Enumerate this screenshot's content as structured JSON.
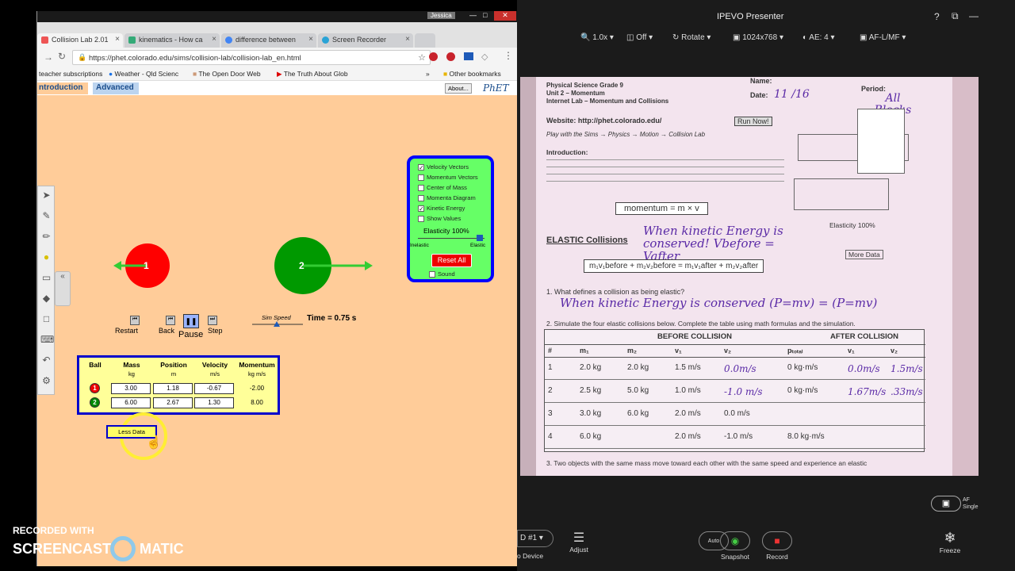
{
  "browser": {
    "titlebar_user": "Jessica",
    "tabs": [
      {
        "label": "Collision Lab 2.01",
        "active": true
      },
      {
        "label": "kinematics - How ca"
      },
      {
        "label": "difference between"
      },
      {
        "label": "Screen Recorder"
      }
    ],
    "url": "https://phet.colorado.edu/sims/collision-lab/collision-lab_en.html",
    "bookmarks": [
      "teacher subscriptions",
      "Weather - Qld Scienc",
      "The Open Door Web",
      "The Truth About Glob",
      "Other bookmarks"
    ]
  },
  "sim": {
    "tabs": {
      "intro": "ntroduction",
      "advanced": "Advanced"
    },
    "about": "About...",
    "logo": "PhET",
    "ball1_label": "1",
    "ball2_label": "2",
    "controls": {
      "restart": "Restart",
      "back": "Back",
      "pause": "Pause",
      "step": "Step"
    },
    "sim_speed": "Sim Speed",
    "time": "Time = 0.75 s",
    "panel": {
      "velocity_vectors": "Velocity Vectors",
      "momentum_vectors": "Momentum Vectors",
      "center_of_mass": "Center of Mass",
      "momenta_diagram": "Momenta Diagram",
      "kinetic_energy": "Kinetic Energy",
      "show_values": "Show Values",
      "elasticity": "Elasticity 100%",
      "inelastic": "Inelastic",
      "elastic": "Elastic",
      "reset_all": "Reset All",
      "sound": "Sound"
    },
    "table": {
      "headers": [
        "Ball",
        "Mass",
        "Position",
        "Velocity",
        "Momentum"
      ],
      "units": [
        "kg",
        "m",
        "m/s",
        "kg m/s"
      ],
      "rows": [
        {
          "ball": "1",
          "mass": "3.00",
          "position": "1.18",
          "velocity": "-0.67",
          "momentum": "-2.00"
        },
        {
          "ball": "2",
          "mass": "6.00",
          "position": "2.67",
          "velocity": "1.30",
          "momentum": "8.00"
        }
      ],
      "less_data": "Less Data"
    }
  },
  "presenter": {
    "title": "IPEVO Presenter",
    "toolbar": {
      "zoom": "1.0x",
      "off": "Off",
      "rotate": "Rotate",
      "resolution": "1024x768",
      "ae": "AE: 4",
      "af": "AF-L/MF"
    },
    "worksheet": {
      "line1": "Physical Science  Grade 9",
      "line2": "Unit 2 – Momentum",
      "line3": "Internet Lab – Momentum and Collisions",
      "name_label": "Name:",
      "date_label": "Date:",
      "date_value": "11 /16",
      "period_label": "Period:",
      "period_value": "All Blocks",
      "website": "Website: http://phet.colorado.edu/",
      "play": "Play with the Sims → Physics → Motion → Collision Lab",
      "run_now": "Run Now!",
      "intro": "Introduction:",
      "momentum_eq": "momentum = m × v",
      "elastic_title": "ELASTIC Collisions",
      "elastic_hw": "When kinetic Energy is conserved! Vbefore = Vafter",
      "equation": "m₁v₁before + m₂v₂before = m₁v₁after + m₂v₂after",
      "more_data": "More Data",
      "elasticity": "Elasticity 100%",
      "q1": "1.  What defines a collision as being elastic?",
      "q1_hw": "When kinetic Energy is conserved  (P=mv) = (P=mv)",
      "q2": "2.  Simulate the four elastic collisions below.  Complete the table using math formulas and the simulation.",
      "before": "BEFORE COLLISION",
      "after": "AFTER COLLISION",
      "cols": [
        "#",
        "m₁",
        "m₂",
        "v₁",
        "v₂",
        "pₜₒₜₐₗ",
        "v₁",
        "v₂"
      ],
      "rows": [
        [
          "1",
          "2.0 kg",
          "2.0 kg",
          "1.5 m/s",
          "0.0m/s",
          "0 kg·m/s",
          "0.0m/s",
          "1.5m/s"
        ],
        [
          "2",
          "2.5 kg",
          "5.0 kg",
          "1.0 m/s",
          "-1.0 m/s",
          "0 kg·m/s",
          "1.67m/s",
          ".33m/s"
        ],
        [
          "3",
          "3.0 kg",
          "6.0 kg",
          "2.0 m/s",
          "0.0 m/s",
          "",
          "",
          ""
        ],
        [
          "4",
          "6.0 kg",
          "",
          "2.0 m/s",
          "-1.0 m/s",
          "8.0 kg·m/s",
          "",
          ""
        ]
      ],
      "q3": "3.  Two objects with the same mass move toward each other with the same speed and experience an elastic"
    },
    "bottom": {
      "device": "D #1",
      "device_label": "o Device",
      "adjust": "Adjust",
      "snapshot": "Snapshot",
      "record": "Record",
      "freeze": "Freeze",
      "auto": "Auto",
      "af": "AF",
      "single": "Single"
    }
  },
  "watermark": {
    "recorded_with": "RECORDED WITH",
    "brand_left": "SCREENCAST",
    "brand_right": "MATIC"
  }
}
